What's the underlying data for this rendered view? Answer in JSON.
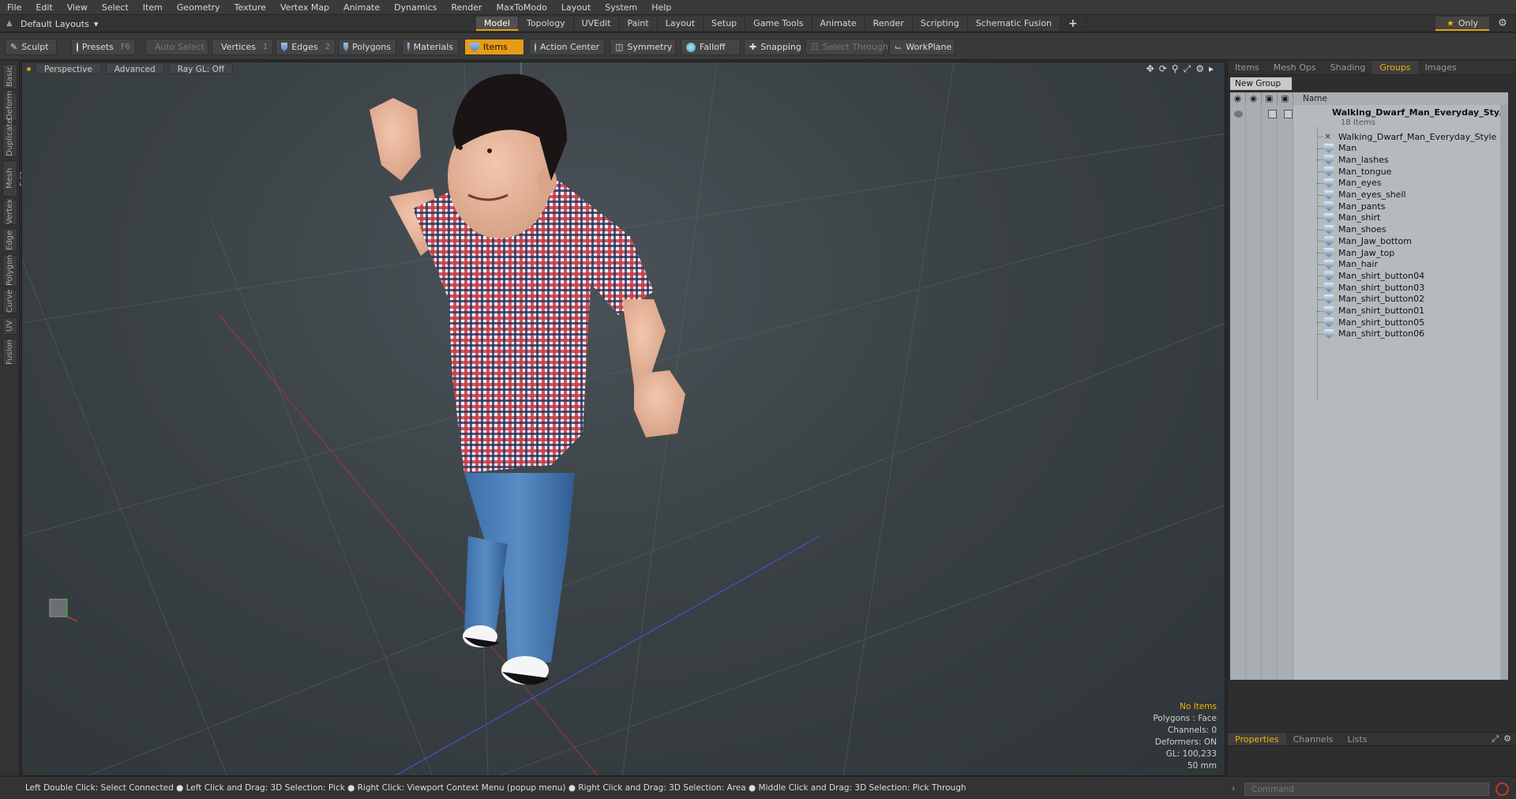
{
  "menu": [
    "File",
    "Edit",
    "View",
    "Select",
    "Item",
    "Geometry",
    "Texture",
    "Vertex Map",
    "Animate",
    "Dynamics",
    "Render",
    "MaxToModo",
    "Layout",
    "System",
    "Help"
  ],
  "layout": {
    "current": "Default Layouts"
  },
  "tabs": [
    "Model",
    "Topology",
    "UVEdit",
    "Paint",
    "Layout",
    "Setup",
    "Game Tools",
    "Animate",
    "Render",
    "Scripting",
    "Schematic Fusion"
  ],
  "tab_add": "+",
  "only_label": "Only",
  "toolbar": {
    "sculpt": "Sculpt",
    "presets": "Presets",
    "presets_key": "F6",
    "auto_select": "Auto Select",
    "vertices": "Vertices",
    "vertices_count": "1",
    "edges": "Edges",
    "edges_count": "2",
    "polygons": "Polygons",
    "materials": "Materials",
    "items": "Items",
    "action_center": "Action Center",
    "symmetry": "Symmetry",
    "falloff": "Falloff",
    "snapping": "Snapping",
    "select_through": "Select Through",
    "workplane": "WorkPlane"
  },
  "left_tabs": [
    "Basic",
    "Deform",
    "Duplicate",
    "Mesh Edit",
    "Vertex",
    "Edge",
    "Polygon",
    "Curve",
    "UV",
    "Fusion"
  ],
  "viewport": {
    "view": "Perspective",
    "style": "Advanced",
    "raygl": "Ray GL: Off",
    "info": {
      "selection": "No Items",
      "polygons": "Polygons : Face",
      "channels": "Channels: 0",
      "deformers": "Deformers: ON",
      "gl": "GL: 100,233",
      "scale": "50 mm"
    }
  },
  "right_panel": {
    "tabs": [
      "Items",
      "Mesh Ops",
      "Shading",
      "Groups",
      "Images"
    ],
    "active_tab": "Groups",
    "new_group": "New Group",
    "name_header": "Name",
    "root": {
      "name": "Walking_Dwarf_Man_Everyday_Sty...",
      "count": "18 Items"
    },
    "items": [
      "Walking_Dwarf_Man_Everyday_Style",
      "Man",
      "Man_lashes",
      "Man_tongue",
      "Man_eyes",
      "Man_eyes_shell",
      "Man_pants",
      "Man_shirt",
      "Man_shoes",
      "Man_Jaw_bottom",
      "Man_Jaw_top",
      "Man_hair",
      "Man_shirt_button04",
      "Man_shirt_button03",
      "Man_shirt_button02",
      "Man_shirt_button01",
      "Man_shirt_button05",
      "Man_shirt_button06"
    ],
    "bottom_tabs": [
      "Properties",
      "Channels",
      "Lists"
    ]
  },
  "statusbar": "Left Double Click: Select Connected ● Left Click and Drag: 3D Selection: Pick ● Right Click: Viewport Context Menu (popup menu) ● Right Click and Drag: 3D Selection: Area ● Middle Click and Drag: 3D Selection: Pick Through",
  "command": {
    "placeholder": "Command"
  },
  "colors": {
    "accent": "#e89b16",
    "panel": "#3a3a3a",
    "tree_bg": "#b5babf",
    "warn": "#f0b400"
  }
}
